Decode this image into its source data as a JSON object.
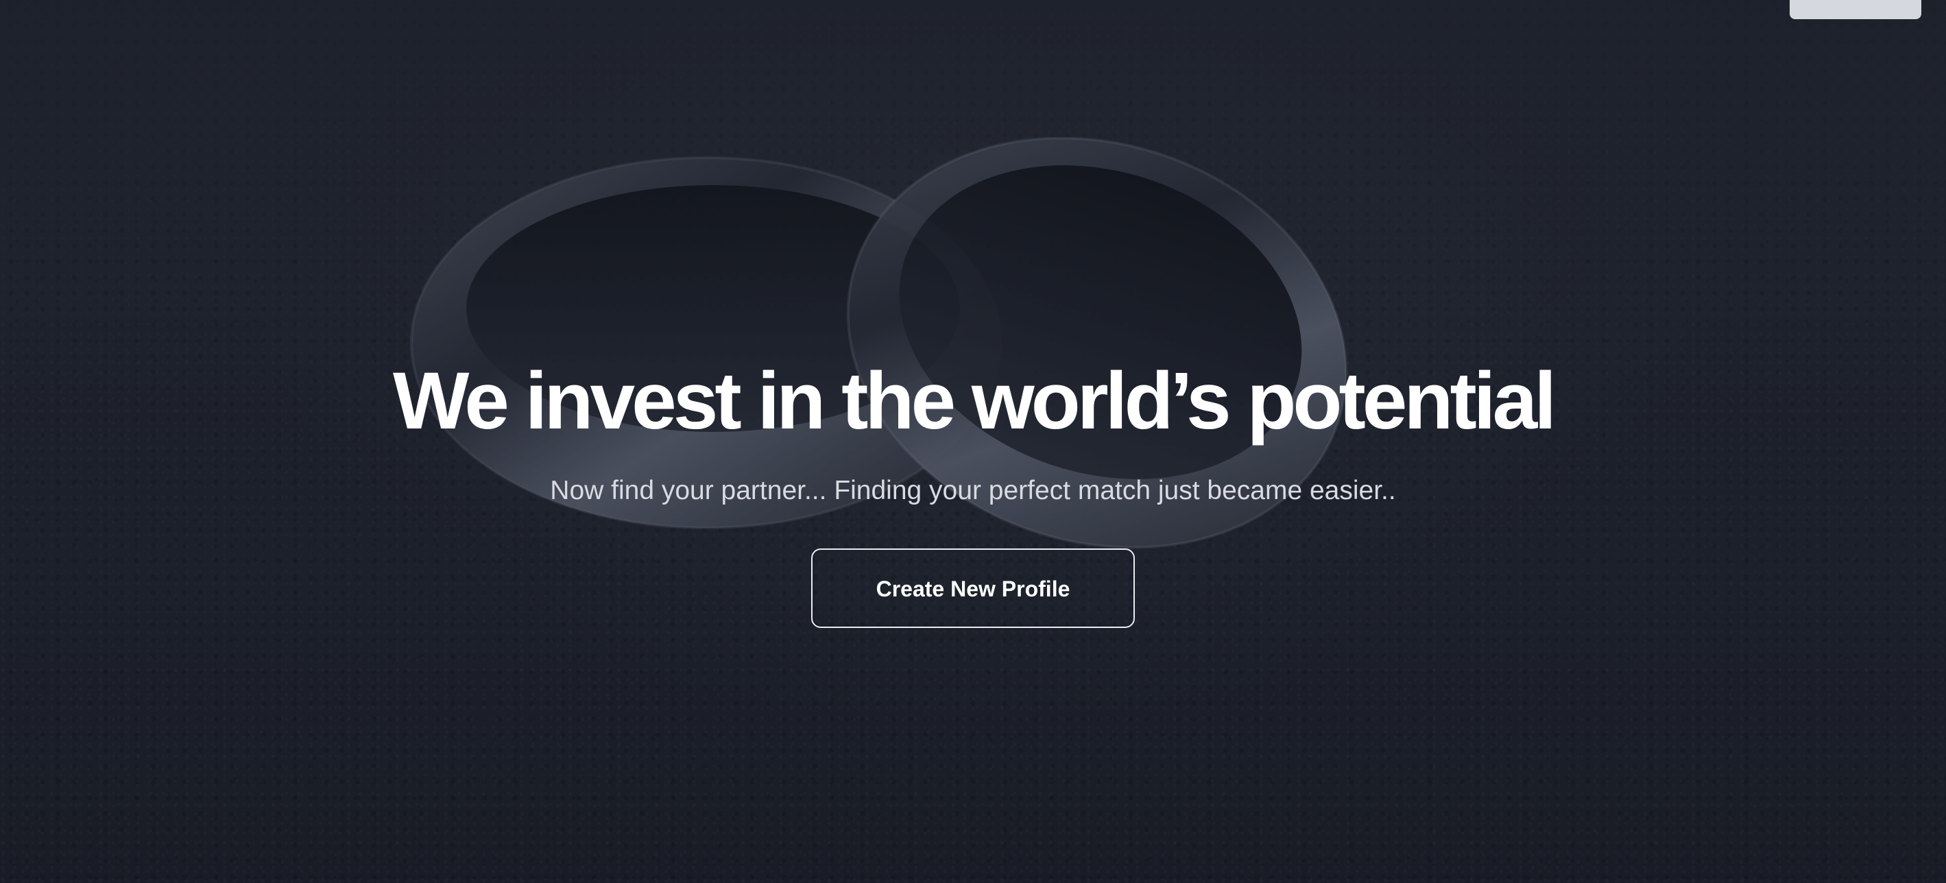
{
  "header": {
    "corner_button_label": ""
  },
  "hero": {
    "headline": "We invest in the world’s potential",
    "subtitle": "Now find your partner... Finding your perfect match just became easier..",
    "cta_label": "Create New Profile",
    "background_image": "wedding-rings-photo"
  },
  "colors": {
    "background": "#1f232c",
    "headline": "#ffffff",
    "subtitle": "#d8dbe1",
    "cta_border": "#e9ebef",
    "corner_button_bg": "#d5d8de"
  }
}
